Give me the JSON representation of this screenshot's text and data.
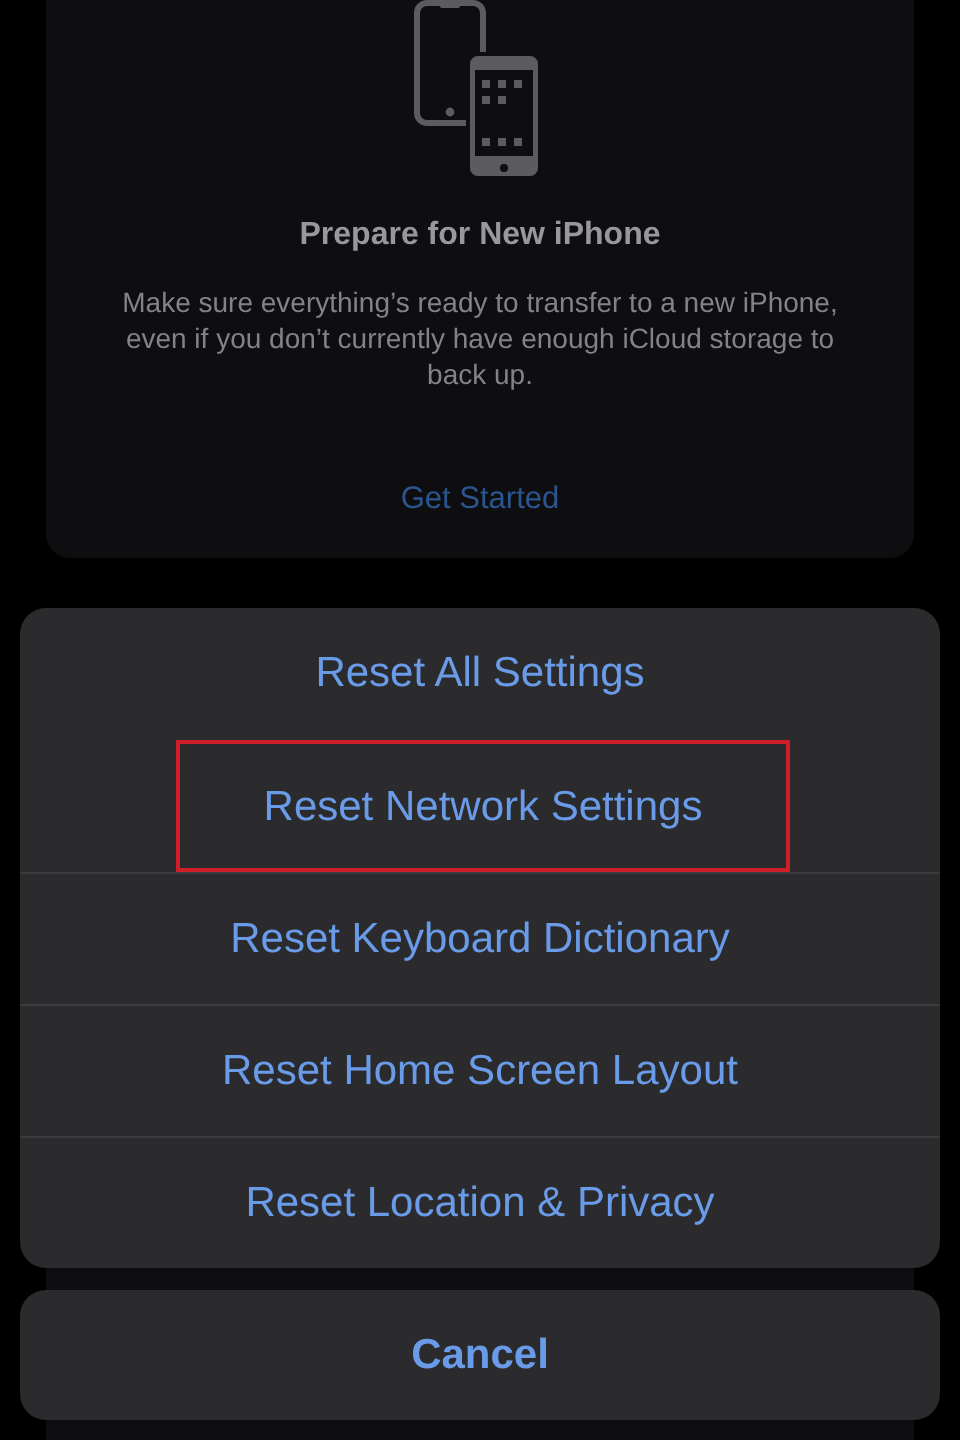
{
  "prepare_card": {
    "title": "Prepare for New iPhone",
    "description": "Make sure everything’s ready to transfer to a new iPhone, even if you don’t currently have enough iCloud storage to back up.",
    "link": "Get Started"
  },
  "action_sheet": {
    "options": [
      {
        "label": "Reset All Settings",
        "highlighted": false
      },
      {
        "label": "Reset Network Settings",
        "highlighted": true
      },
      {
        "label": "Reset Keyboard Dictionary",
        "highlighted": false
      },
      {
        "label": "Reset Home Screen Layout",
        "highlighted": false
      },
      {
        "label": "Reset Location & Privacy",
        "highlighted": false
      }
    ],
    "cancel": "Cancel"
  }
}
